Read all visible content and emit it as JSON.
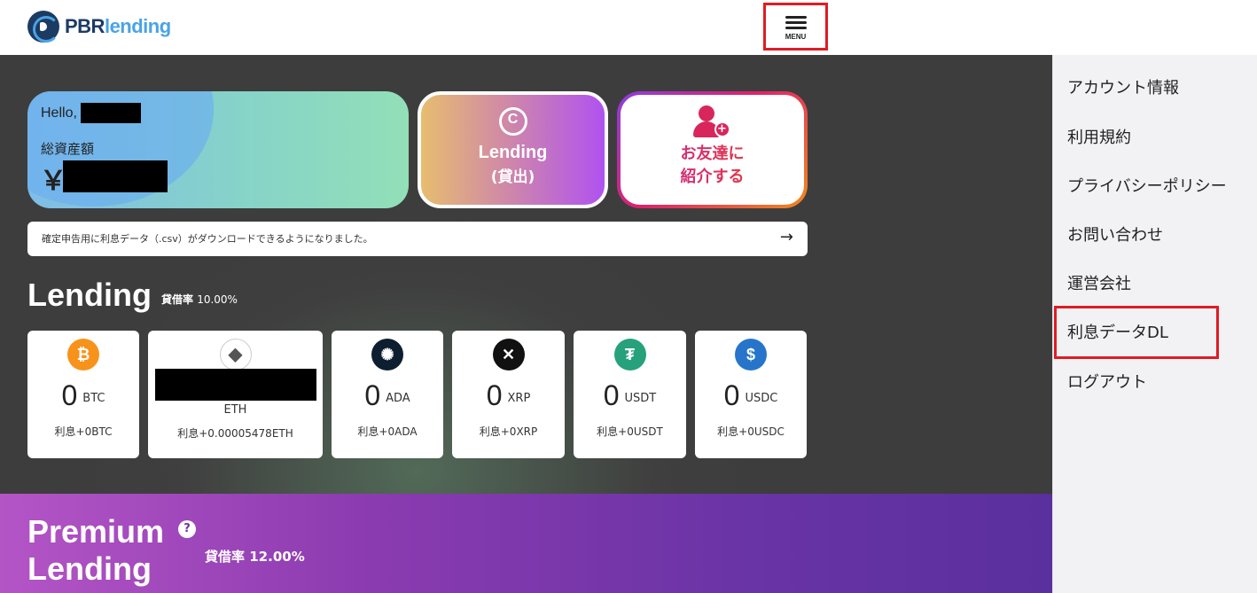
{
  "header": {
    "logo_text_1": "PBR",
    "logo_text_2": "lending",
    "menu_label": "MENU"
  },
  "summary": {
    "hello_label": "Hello,",
    "total_assets_label": "総資産額",
    "currency_symbol": "￥"
  },
  "actions": {
    "lending_label": "Lending",
    "lending_sub": "(貸出)",
    "invite_line1": "お友達に",
    "invite_line2": "紹介する"
  },
  "notice": {
    "text": "確定申告用に利息データ（.csv）がダウンロードできるようになりました。",
    "arrow": "→"
  },
  "lending": {
    "title": "Lending",
    "rate_label": "貸借率",
    "rate_value": "10.00%",
    "coins": [
      {
        "symbol": "BTC",
        "amount": "0",
        "interest": "利息+0BTC",
        "icon": "bitcoin-icon",
        "color": "#f7931a",
        "glyph": "₿"
      },
      {
        "symbol": "ETH",
        "amount": "",
        "interest": "利息+0.00005478ETH",
        "icon": "ethereum-icon",
        "color": "#ffffff",
        "glyph": "◆"
      },
      {
        "symbol": "ADA",
        "amount": "0",
        "interest": "利息+0ADA",
        "icon": "cardano-icon",
        "color": "#0d1e30",
        "glyph": "✺"
      },
      {
        "symbol": "XRP",
        "amount": "0",
        "interest": "利息+0XRP",
        "icon": "xrp-icon",
        "color": "#111111",
        "glyph": "✕"
      },
      {
        "symbol": "USDT",
        "amount": "0",
        "interest": "利息+0USDT",
        "icon": "tether-icon",
        "color": "#26a17b",
        "glyph": "₮"
      },
      {
        "symbol": "USDC",
        "amount": "0",
        "interest": "利息+0USDC",
        "icon": "usdc-icon",
        "color": "#2775ca",
        "glyph": "$"
      }
    ]
  },
  "premium": {
    "title_line1": "Premium",
    "title_line2": "Lending",
    "help": "?",
    "rate_label": "貸借率",
    "rate_value": "12.00%"
  },
  "sidebar": {
    "items": [
      {
        "label": "アカウント情報"
      },
      {
        "label": "利用規約"
      },
      {
        "label": "プライバシーポリシー"
      },
      {
        "label": "お問い合わせ"
      },
      {
        "label": "運営会社"
      },
      {
        "label": "利息データDL"
      },
      {
        "label": "ログアウト"
      }
    ]
  },
  "colors": {
    "highlight": "#e01b24",
    "dark_bg": "#3f3f3f",
    "brand_navy": "#1c3b63",
    "brand_blue": "#4aa3e6"
  }
}
